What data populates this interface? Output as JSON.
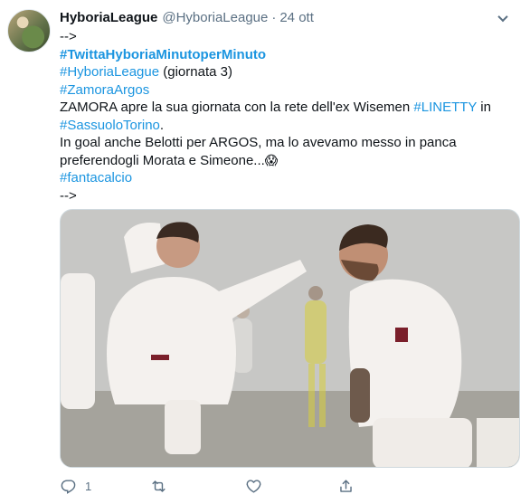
{
  "tweet": {
    "display_name": "HyboriaLeague",
    "handle": "@HyboriaLeague",
    "separator": "·",
    "date": "24 ott",
    "lines": {
      "l1": "-->",
      "l2_tag": "#TwittaHyboriaMinutoperMinuto",
      "l3_tag": "#HyboriaLeague",
      "l3_text": " (giornata 3)",
      "l4_tag": "#ZamoraArgos",
      "l5_text": "ZAMORA apre la sua giornata con la rete dell'ex Wisemen ",
      "l5_tag": "#LINETTY",
      "l5_tail": " in",
      "l6_tag": "#SassuoloTorino",
      "l6_tail": ".",
      "l7_text": "In goal anche Belotti per ARGOS, ma lo avevamo messo in panca",
      "l8_text": "preferendogli Morata e Simeone...",
      "l8_emoji": "😱",
      "l9_tag": "#fantacalcio",
      "l10": "-->"
    },
    "media": {
      "description_icon": "photo-football-celebration"
    },
    "actions": {
      "reply_count": "1",
      "retweet_count": "",
      "like_count": ""
    },
    "colors": {
      "link": "#1b95e0",
      "muted": "#5b7083",
      "text": "#0f1419"
    }
  }
}
